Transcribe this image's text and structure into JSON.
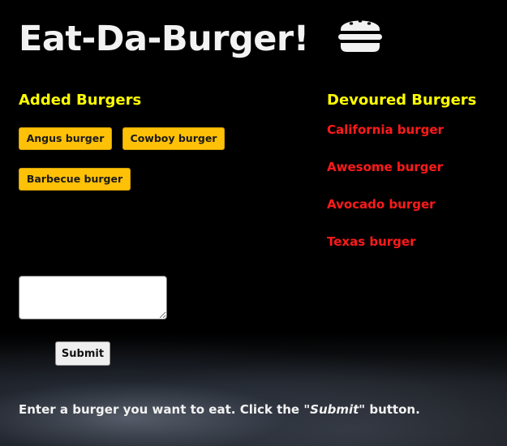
{
  "app": {
    "title": "Eat-Da-Burger!",
    "title_icon": "hamburger-icon"
  },
  "added": {
    "heading": "Added Burgers",
    "burgers": [
      "Angus burger",
      "Cowboy burger",
      "Barbecue burger"
    ]
  },
  "devoured": {
    "heading": "Devoured Burgers",
    "burgers": [
      "California burger",
      "Awesome burger",
      "Avocado burger",
      "Texas burger"
    ]
  },
  "form": {
    "input_value": "",
    "submit_label": "Submit"
  },
  "instructions": {
    "before": "Enter a burger you want to eat. Click the ",
    "quoted": "\"Submit\"",
    "after": " button."
  },
  "colors": {
    "background": "#000000",
    "heading": "#ffff00",
    "chip": "#ffc107",
    "devoured_text": "#ff1a1a",
    "title_text": "#f2f2f2"
  }
}
